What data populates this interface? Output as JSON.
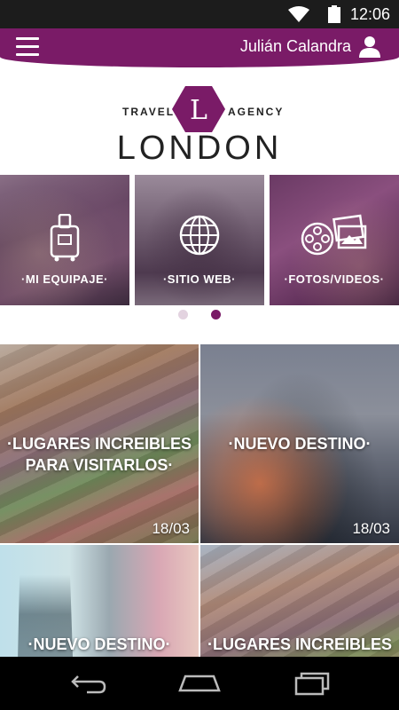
{
  "status_bar": {
    "time": "12:06"
  },
  "app_bar": {
    "user_name": "Julián Calandra",
    "accent_color": "#7a1b67"
  },
  "logo": {
    "travel": "TRAVEL",
    "letter": "L",
    "agency": "AGENCY",
    "city": "LONDON"
  },
  "shortcuts": [
    {
      "label": "·MI EQUIPAJE·",
      "icon": "luggage-icon"
    },
    {
      "label": "·SITIO WEB·",
      "icon": "globe-icon"
    },
    {
      "label": "·FOTOS/VIDEOS·",
      "icon": "photos-videos-icon"
    }
  ],
  "carousel_pages": {
    "count": 2,
    "active": 2
  },
  "cards": [
    {
      "title": "·LUGARES INCREIBLES PARA VISITARLOS·",
      "date": "18/03"
    },
    {
      "title": "·NUEVO DESTINO·",
      "date": "18/03"
    },
    {
      "title": "·NUEVO DESTINO·",
      "date": ""
    },
    {
      "title": "·LUGARES INCREIBLES",
      "date": ""
    }
  ],
  "nav_bar": {
    "back": "back-icon",
    "home": "home-icon",
    "recents": "recents-icon"
  }
}
